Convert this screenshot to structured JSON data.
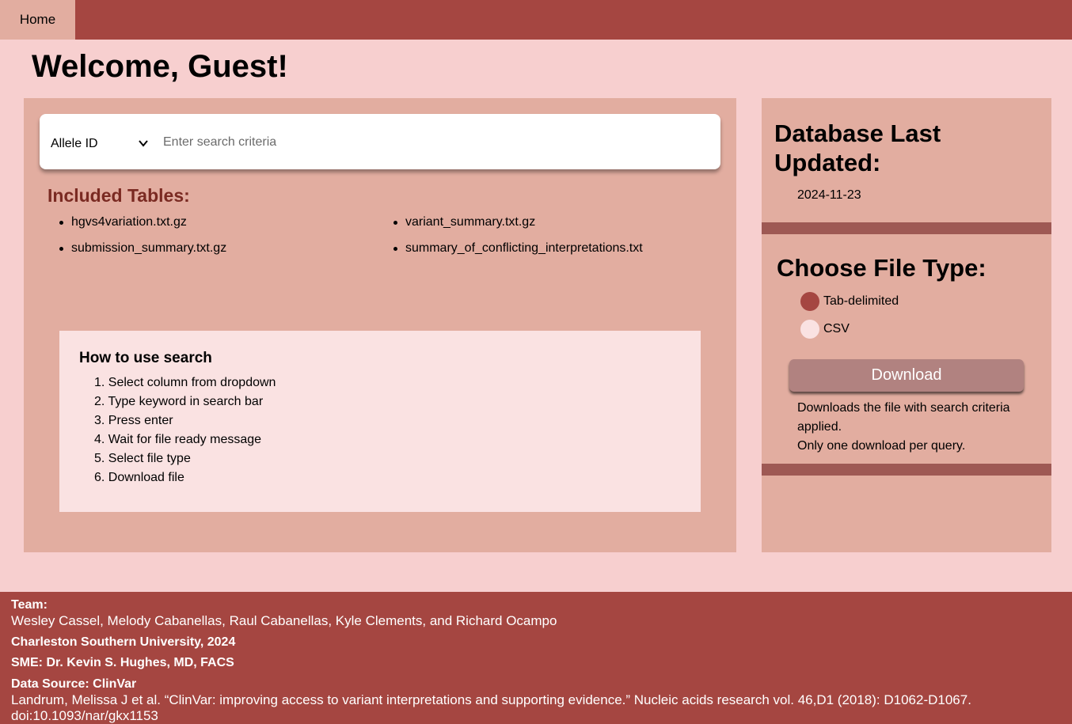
{
  "nav": {
    "home_label": "Home"
  },
  "welcome": "Welcome, Guest!",
  "search": {
    "column_selected": "Allele ID",
    "placeholder": "Enter search criteria",
    "value": ""
  },
  "tables": {
    "heading": "Included Tables:",
    "items": [
      "hgvs4variation.txt.gz",
      "variant_summary.txt.gz",
      "submission_summary.txt.gz",
      "summary_of_conflicting_interpretations.txt"
    ]
  },
  "howto": {
    "title": "How to use search",
    "steps": [
      "1. Select column from dropdown",
      "2. Type keyword in search bar",
      "3. Press enter",
      "4. Wait for file ready message",
      "5. Select file type",
      "6. Download file"
    ]
  },
  "database": {
    "title": "Database Last Updated:",
    "date": "2024-11-23"
  },
  "file_type": {
    "title": "Choose File Type:",
    "options": [
      "Tab-delimited",
      "CSV"
    ],
    "selected": "Tab-delimited"
  },
  "download": {
    "label": "Download",
    "note_line1": "Downloads the file with search criteria applied.",
    "note_line2": "Only one download per query."
  },
  "footer": {
    "team_label": "Team:",
    "team_members": "Wesley Cassel, Melody Cabanellas, Raul Cabanellas, Kyle Clements, and Richard Ocampo",
    "university": "Charleston Southern University, 2024",
    "sme": "SME: Dr. Kevin S. Hughes, MD, FACS",
    "data_source": "Data Source: ClinVar",
    "citation": "Landrum, Melissa J et al. “ClinVar: improving access to variant interpretations and supporting evidence.” Nucleic acids research vol. 46,D1 (2018): D1062-D1067.",
    "doi": "doi:10.1093/nar/gkx1153"
  },
  "colors": {
    "nav_bg": "#a54641",
    "page_bg": "#f7cfcf",
    "panel_bg": "#e2ada0",
    "accent": "#a54641",
    "button_bg": "#b18280"
  }
}
